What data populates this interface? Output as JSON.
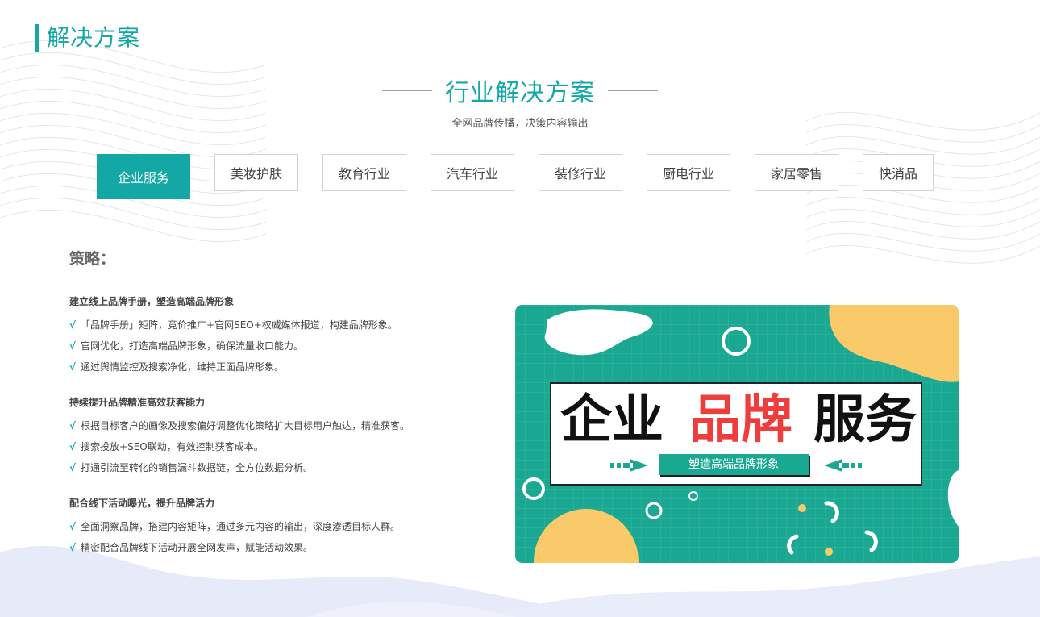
{
  "page": {
    "header_title": "解决方案",
    "section_title": "行业解决方案",
    "section_subtitle": "全网品牌传播，决策内容输出"
  },
  "tabs": [
    {
      "label": "企业服务",
      "active": true
    },
    {
      "label": "美妆护肤",
      "active": false
    },
    {
      "label": "教育行业",
      "active": false
    },
    {
      "label": "汽车行业",
      "active": false
    },
    {
      "label": "装修行业",
      "active": false
    },
    {
      "label": "厨电行业",
      "active": false
    },
    {
      "label": "家居零售",
      "active": false
    },
    {
      "label": "快消品",
      "active": false
    }
  ],
  "strategy": {
    "title": "策略：",
    "check_mark": "√",
    "groups": [
      {
        "heading": "建立线上品牌手册，塑造高端品牌形象",
        "items": [
          "「品牌手册」矩阵，竞价推广+官网SEO+权威媒体报道，构建品牌形象。",
          "官网优化，打造高端品牌形象，确保流量收口能力。",
          "通过舆情监控及搜索净化，维持正面品牌形象。"
        ]
      },
      {
        "heading": "持续提升品牌精准高效获客能力",
        "items": [
          "根据目标客户的画像及搜索偏好调整优化策略扩大目标用户触达，精准获客。",
          "搜索投放+SEO联动，有效控制获客成本。",
          "打通引流至转化的销售漏斗数据链，全方位数据分析。"
        ]
      },
      {
        "heading": "配合线下活动曝光，提升品牌活力",
        "items": [
          "全面洞察品牌，搭建内容矩阵，通过多元内容的输出，深度渗透目标人群。",
          "精密配合品牌线下活动开展全网发声，赋能活动效果。"
        ]
      }
    ]
  },
  "banner": {
    "word1": "企业",
    "word2": "品牌",
    "word3": "服务",
    "tagline": "塑造高端品牌形象"
  },
  "colors": {
    "accent": "#13a8a6",
    "banner_bg": "#1aa892",
    "banner_yellow": "#fac96a",
    "highlight_red": "#ee3d3d"
  }
}
